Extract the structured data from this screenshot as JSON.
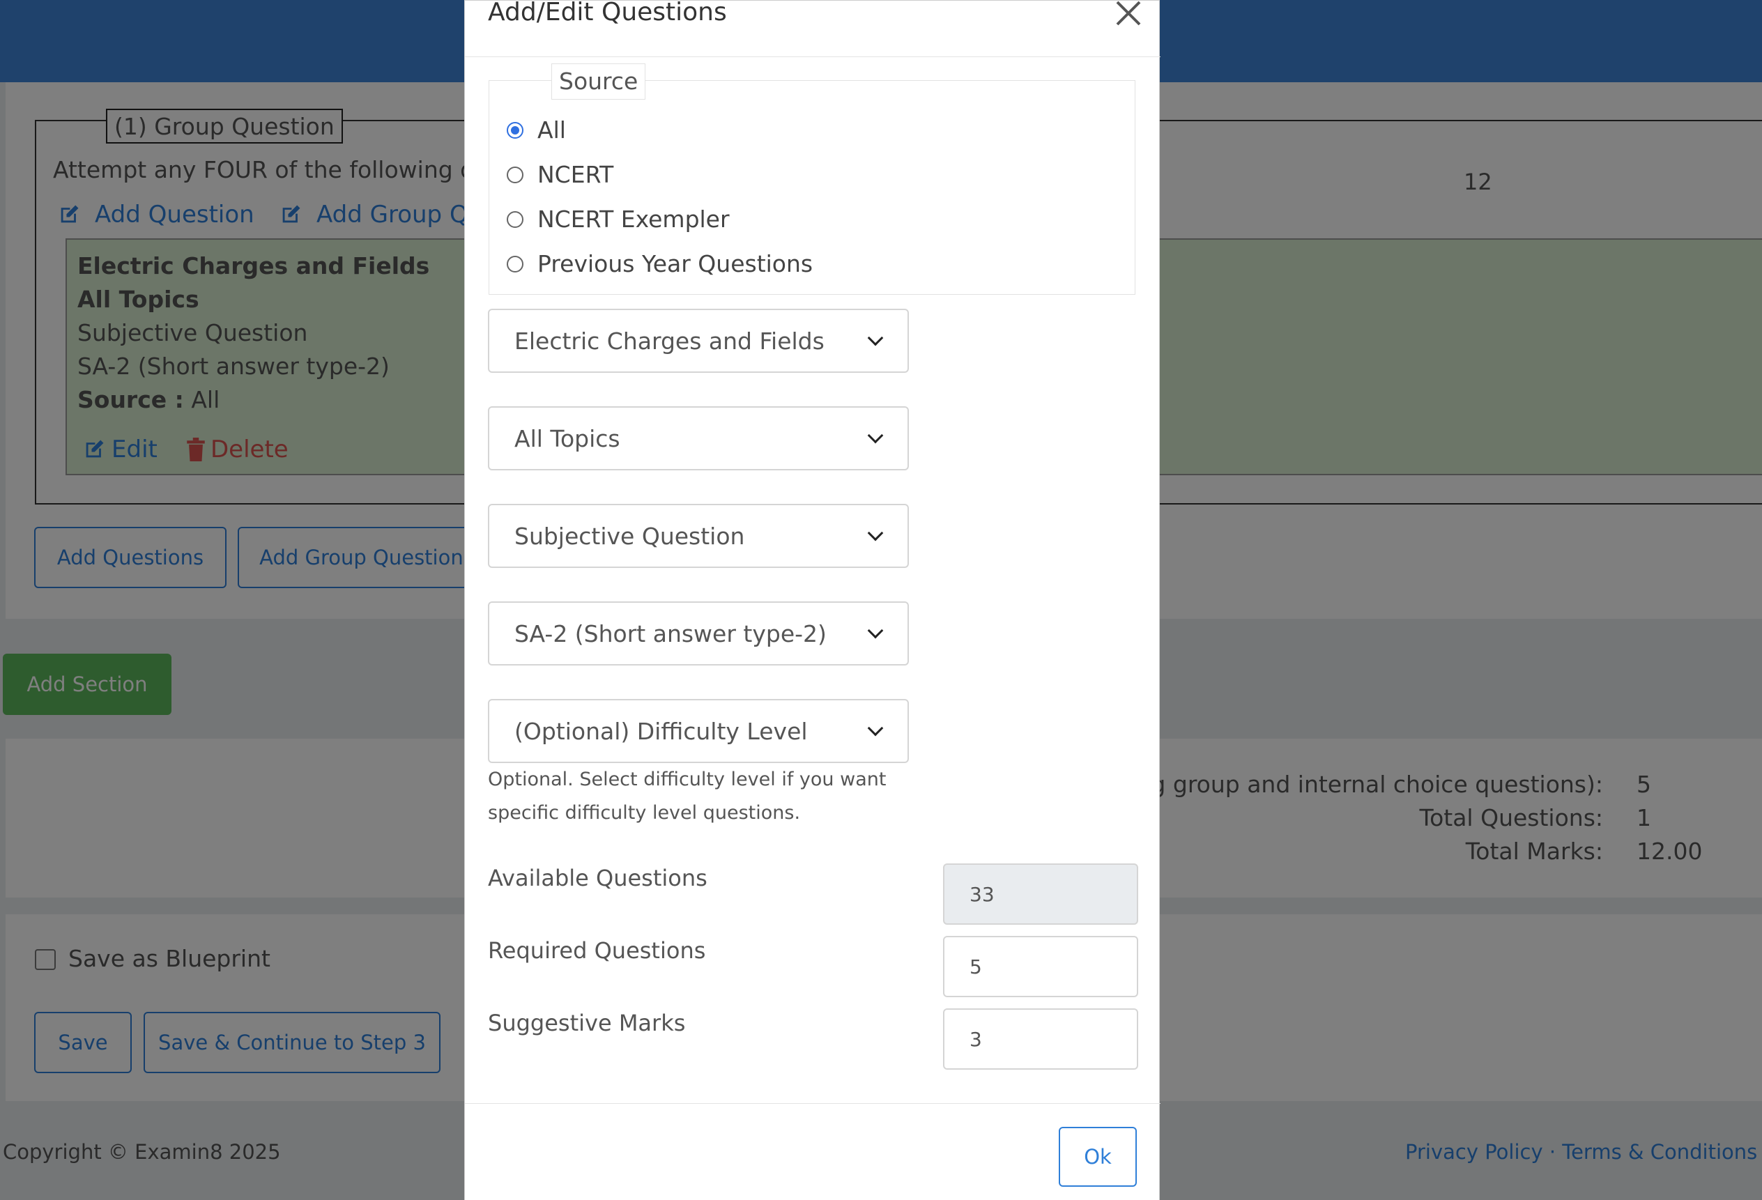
{
  "section": {
    "group_question_legend": "(1) Group Question",
    "instruction": "Attempt any FOUR of the following qu",
    "marks": "12",
    "add_question_link": "Add Question",
    "add_group_question_link": "Add Group Qu",
    "card": {
      "chapter": "Electric Charges and Fields",
      "topics": "All Topics",
      "question_type": "Subjective Question",
      "question_subtype": "SA-2 (Short answer type-2)",
      "source_label": "Source :",
      "source_value": "All",
      "edit": "Edit",
      "delete": "Delete"
    },
    "add_questions_button": "Add Questions",
    "add_group_questions_button": "Add Group Questions"
  },
  "add_section_button": "Add Section",
  "summary": {
    "row1_label": "ding group and internal choice questions):",
    "row1_value": "5",
    "row2_label": "Total Questions:",
    "row2_value": "1",
    "row3_label": "Total Marks:",
    "row3_value": "12.00"
  },
  "blueprint": {
    "save_as_blueprint": "Save as Blueprint",
    "save_button": "Save",
    "save_continue_button": "Save & Continue to Step 3"
  },
  "footer": {
    "copyright": "Copyright © Examin8 2025",
    "links": "Privacy Policy · Terms & Conditions · R"
  },
  "modal": {
    "title": "Add/Edit Questions",
    "source_legend": "Source",
    "source_options": [
      "All",
      "NCERT",
      "NCERT Exempler",
      "Previous Year Questions"
    ],
    "selected_source": "All",
    "chapter_select": "Electric Charges and Fields",
    "topic_select": "All Topics",
    "type_select": "Subjective Question",
    "subtype_select": "SA-2 (Short answer type-2)",
    "difficulty_select": "(Optional) Difficulty Level",
    "difficulty_help": "Optional. Select difficulty level if you want specific difficulty level questions.",
    "available_label": "Available Questions",
    "available_value": "33",
    "required_label": "Required Questions",
    "required_value": "5",
    "marks_label": "Suggestive Marks",
    "marks_value": "3",
    "ok_button": "Ok"
  },
  "colors": {
    "primary": "#2f7fd8",
    "success": "#5cb85c",
    "danger": "#d9534f",
    "header": "#3f84d8",
    "card_bg": "#d9ecd0"
  }
}
